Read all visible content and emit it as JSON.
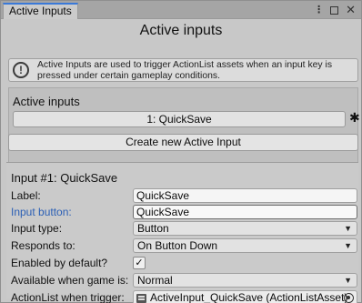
{
  "window": {
    "tab_label": "Active Inputs"
  },
  "editor": {
    "title": "Active inputs",
    "help_text": "Active Inputs are used to trigger ActionList assets when an input key is pressed under certain gameplay conditions."
  },
  "inputs_list": {
    "heading": "Active inputs",
    "items": [
      {
        "label": "1: QuickSave"
      }
    ],
    "create_button": "Create new Active Input"
  },
  "detail": {
    "heading": "Input #1: QuickSave",
    "fields": {
      "label": {
        "name": "Label:",
        "value": "QuickSave"
      },
      "input_button": {
        "name": "Input button:",
        "value": "QuickSave"
      },
      "input_type": {
        "name": "Input type:",
        "value": "Button"
      },
      "responds_to": {
        "name": "Responds to:",
        "value": "On Button Down"
      },
      "enabled_by_default": {
        "name": "Enabled by default?",
        "checked": true,
        "check_glyph": "✓"
      },
      "available_when": {
        "name": "Available when game is:",
        "value": "Normal"
      },
      "actionlist": {
        "name": "ActionList when trigger:",
        "value": "ActiveInput_QuickSave (ActionListAsset)"
      }
    }
  },
  "icons": {
    "help": "info-icon",
    "gear": "gear-icon",
    "dropdown": "chevron-down-icon",
    "asset": "actionlist-asset-icon",
    "picker": "object-picker-icon"
  },
  "colors": {
    "accent_tab": "#3a79d8",
    "highlight_label": "#2b5fb5",
    "panel_bg": "#c8c8c8"
  }
}
